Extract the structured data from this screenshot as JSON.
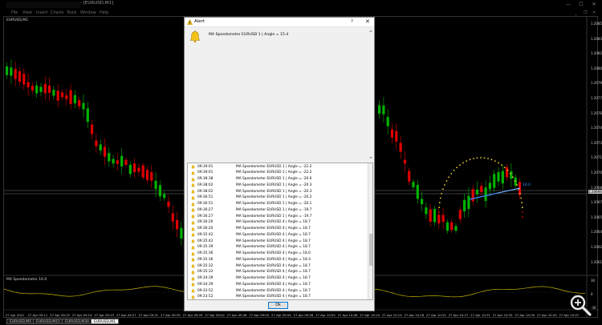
{
  "window": {
    "title": "- [EURUSD,M1]",
    "minimize_glyph": "—",
    "maximize_glyph": "☐",
    "close_glyph": "✕"
  },
  "menu": [
    "File",
    "View",
    "Insert",
    "Charts",
    "Tools",
    "Window",
    "Help"
  ],
  "menu_controls": [
    "_",
    "❐",
    "✕"
  ],
  "chart": {
    "symbol_label": "EURUSD,M1",
    "price_ticks": [
      "1.20850",
      "1.20835",
      "1.20820",
      "1.20805",
      "1.20790",
      "1.20775",
      "1.20760",
      "1.20745",
      "1.20730",
      "1.20715",
      "1.20700",
      "1.20685",
      "1.20670",
      "1.20655",
      "1.20640",
      "1.20625",
      "1.20610"
    ],
    "current_price": "1.20694",
    "angle_value": "16.0",
    "indicator_label": "MA Speedometer 16.0",
    "indicator_ticks": [
      "30",
      "0",
      "-30"
    ],
    "time_ticks": [
      "27 Apr 2021",
      "27 Apr 09:11",
      "27 Apr 09:15",
      "27 Apr 09:19",
      "27 Apr 09:23",
      "27 Apr 09:27",
      "27 Apr 09:31",
      "27 Apr 09:35",
      "27 Apr 09:39",
      "27 Apr 09:42",
      "27 Apr 09:46",
      "27 Apr 09:50",
      "27 Apr 09:54",
      "27 Apr 09:58",
      "27 Apr 10:02",
      "27 Apr 10:06",
      "27 Apr 10:10",
      "27 Apr 10:14",
      "27 Apr 10:18",
      "27 Apr 10:22",
      "27 Apr 10:27",
      "27 Apr 10:31",
      "27 Apr 10:35",
      "27 Apr 10:39",
      "27 Apr 10:43",
      "27 Apr 10:47"
    ],
    "colors": {
      "bull": "#00b300",
      "bear": "#e00000",
      "arc": "#f2d230",
      "arc_end": "#e00000",
      "ma_line": "#3d8bff",
      "grid": "#1c1c1c",
      "ind_line": "#c8b400"
    }
  },
  "tabs": [
    {
      "label": "EURUSD,M5",
      "active": false
    },
    {
      "label": "EURUSD,M15",
      "active": false
    },
    {
      "label": "EURUSD,M30",
      "active": false
    },
    {
      "label": "EURUSD,M1",
      "active": true
    }
  ],
  "alert": {
    "title": "Alert",
    "help_glyph": "?",
    "close_glyph": "✕",
    "message": "MA Speedometer EURUSD 1 | Angle = 15.4",
    "ok_label": "Ok",
    "rows": [
      {
        "time": "09:39:01",
        "text": "MA Speedometer EURUSD 1 | Angle = -22.2"
      },
      {
        "time": "09:39:01",
        "text": "MA Speedometer EURUSD 1 | Angle = -22.2"
      },
      {
        "time": "09:38:38",
        "text": "MA Speedometer EURUSD 1 | Angle = -20.6"
      },
      {
        "time": "09:38:02",
        "text": "MA Speedometer EURUSD 1 | Angle = -20.3"
      },
      {
        "time": "09:38:02",
        "text": "MA Speedometer EURUSD 1 | Angle = -20.3"
      },
      {
        "time": "09:36:51",
        "text": "MA Speedometer EURUSD 1 | Angle = -20.2"
      },
      {
        "time": "09:36:51",
        "text": "MA Speedometer EURUSD 1 | Angle = -20.1"
      },
      {
        "time": "09:36:27",
        "text": "MA Speedometer EURUSD 1 | Angle = -19.7"
      },
      {
        "time": "09:36:27",
        "text": "MA Speedometer EURUSD 1 | Angle = -19.7"
      },
      {
        "time": "09:36:20",
        "text": "MA Speedometer EURUSD 4 | Angle = 18.7"
      },
      {
        "time": "09:36:20",
        "text": "MA Speedometer EURUSD 4 | Angle = 18.7"
      },
      {
        "time": "09:35:42",
        "text": "MA Speedometer EURUSD 4 | Angle = 18.7"
      },
      {
        "time": "09:35:42",
        "text": "MA Speedometer EURUSD 4 | Angle = 18.7"
      },
      {
        "time": "09:35:39",
        "text": "MA Speedometer EURUSD 4 | Angle = 18.7"
      },
      {
        "time": "09:35:36",
        "text": "MA Speedometer EURUSD 4 | Angle = 18.0"
      },
      {
        "time": "09:35:36",
        "text": "MA Speedometer EURUSD 4 | Angle = 18.3"
      },
      {
        "time": "09:35:32",
        "text": "MA Speedometer EURUSD 4 | Angle = 18.7"
      },
      {
        "time": "09:35:32",
        "text": "MA Speedometer EURUSD 4 | Angle = 18.7"
      },
      {
        "time": "09:34:39",
        "text": "MA Speedometer EURUSD 4 | Angle = 18.7"
      },
      {
        "time": "09:34:39",
        "text": "MA Speedometer EURUSD 4 | Angle = 18.7"
      },
      {
        "time": "09:33:52",
        "text": "MA Speedometer EURUSD 4 | Angle = 18.7"
      },
      {
        "time": "09:33:52",
        "text": "MA Speedometer EURUSD 4 | Angle = 18.7"
      }
    ]
  }
}
